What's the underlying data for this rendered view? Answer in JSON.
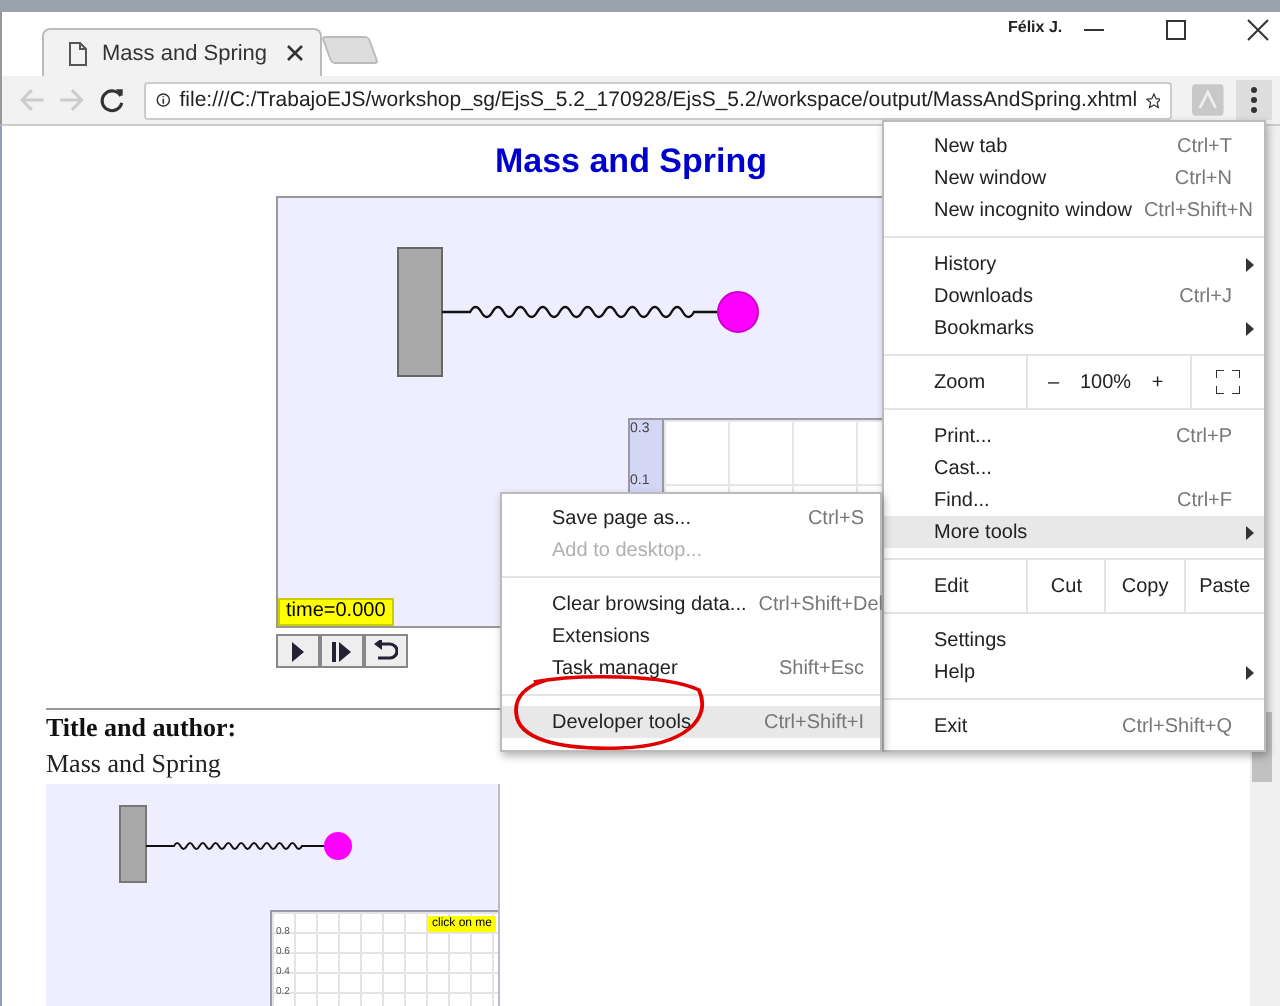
{
  "window": {
    "tab_title": "Mass and Spring",
    "user": "Félix J.",
    "address": "file:///C:/TrabajoEJS/workshop_sg/EjsS_5.2_170928/EjsS_5.2/workspace/output/MassAndSpring.xhtml"
  },
  "page": {
    "heading": "Mass and Spring",
    "simulation": {
      "time_label": "time=0.000",
      "graph_ticks": [
        "0.3",
        "0.1"
      ]
    },
    "controls": [
      {
        "kind": "play"
      },
      {
        "kind": "step"
      },
      {
        "kind": "reset"
      }
    ],
    "section_title": "Title and author:",
    "section_text": "Mass and Spring",
    "preview": {
      "button": "click on me",
      "graph_ticks": [
        "0.8",
        "0.6",
        "0.4",
        "0.2"
      ]
    }
  },
  "main_menu": [
    [
      {
        "kind": "item",
        "label": "New tab",
        "shortcut": "Ctrl+T",
        "submenu": false,
        "selected": false
      },
      {
        "kind": "item",
        "label": "New window",
        "shortcut": "Ctrl+N",
        "submenu": false,
        "selected": false
      },
      {
        "kind": "item",
        "label": "New incognito window",
        "shortcut": "Ctrl+Shift+N",
        "submenu": false,
        "selected": false
      }
    ],
    [
      {
        "kind": "item",
        "label": "History",
        "submenu": true,
        "selected": false
      },
      {
        "kind": "item",
        "label": "Downloads",
        "shortcut": "Ctrl+J",
        "submenu": false,
        "selected": false
      },
      {
        "kind": "item",
        "label": "Bookmarks",
        "submenu": true,
        "selected": false
      }
    ],
    [
      {
        "kind": "zoom",
        "label": "Zoom",
        "minus": "–",
        "value": "100%",
        "plus": "+"
      }
    ],
    [
      {
        "kind": "item",
        "label": "Print...",
        "shortcut": "Ctrl+P",
        "submenu": false,
        "selected": false
      },
      {
        "kind": "item",
        "label": "Cast...",
        "submenu": false,
        "selected": false
      },
      {
        "kind": "item",
        "label": "Find...",
        "shortcut": "Ctrl+F",
        "submenu": false,
        "selected": false
      },
      {
        "kind": "item",
        "label": "More tools",
        "submenu": true,
        "selected": true
      }
    ],
    [
      {
        "kind": "edit",
        "label": "Edit",
        "buttons": [
          "Cut",
          "Copy",
          "Paste"
        ]
      }
    ],
    [
      {
        "kind": "item",
        "label": "Settings",
        "submenu": false,
        "selected": false
      },
      {
        "kind": "item",
        "label": "Help",
        "submenu": true,
        "selected": false
      }
    ],
    [
      {
        "kind": "item",
        "label": "Exit",
        "shortcut": "Ctrl+Shift+Q",
        "submenu": false,
        "selected": false
      }
    ]
  ],
  "more_tools_menu": [
    [
      {
        "label": "Save page as...",
        "shortcut": "Ctrl+S",
        "disabled": false,
        "selected": false
      },
      {
        "label": "Add to desktop...",
        "disabled": true,
        "selected": false
      }
    ],
    [
      {
        "label": "Clear browsing data...",
        "shortcut": "Ctrl+Shift+Del",
        "disabled": false,
        "selected": false
      },
      {
        "label": "Extensions",
        "disabled": false,
        "selected": false
      },
      {
        "label": "Task manager",
        "shortcut": "Shift+Esc",
        "disabled": false,
        "selected": false
      }
    ],
    [
      {
        "label": "Developer tools",
        "shortcut": "Ctrl+Shift+I",
        "disabled": false,
        "selected": true
      }
    ]
  ]
}
